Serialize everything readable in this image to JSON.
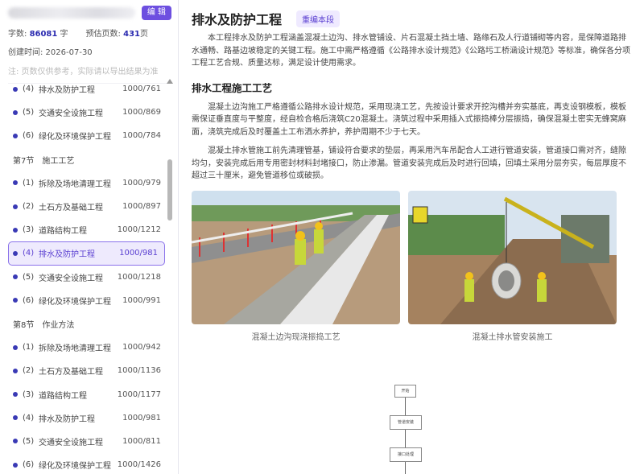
{
  "sidebar": {
    "edit_label": "编 辑",
    "word_count_label": "字数:",
    "word_count": "86081",
    "word_unit": "字",
    "pages_label": "预估页数:",
    "pages": "431",
    "pages_unit": "页",
    "created": "创建时间: 2026-07-30",
    "note": "注: 页数仅供参考，实际请以导出结果为准",
    "toc": [
      {
        "type": "item",
        "num": "(4)",
        "label": "排水及防护工程",
        "pages": "1000/761"
      },
      {
        "type": "item",
        "num": "(5)",
        "label": "交通安全设施工程",
        "pages": "1000/869"
      },
      {
        "type": "item",
        "num": "(6)",
        "label": "绿化及环境保护工程",
        "pages": "1000/784"
      },
      {
        "type": "section",
        "label": "第7节　施工工艺"
      },
      {
        "type": "item",
        "num": "(1)",
        "label": "拆除及场地清理工程",
        "pages": "1000/979"
      },
      {
        "type": "item",
        "num": "(2)",
        "label": "土石方及基础工程",
        "pages": "1000/897"
      },
      {
        "type": "item",
        "num": "(3)",
        "label": "道路结构工程",
        "pages": "1000/1212"
      },
      {
        "type": "item",
        "num": "(4)",
        "label": "排水及防护工程",
        "pages": "1000/981",
        "active": true
      },
      {
        "type": "item",
        "num": "(5)",
        "label": "交通安全设施工程",
        "pages": "1000/1218"
      },
      {
        "type": "item",
        "num": "(6)",
        "label": "绿化及环境保护工程",
        "pages": "1000/991"
      },
      {
        "type": "section",
        "label": "第8节　作业方法"
      },
      {
        "type": "item",
        "num": "(1)",
        "label": "拆除及场地清理工程",
        "pages": "1000/942"
      },
      {
        "type": "item",
        "num": "(2)",
        "label": "土石方及基础工程",
        "pages": "1000/1136"
      },
      {
        "type": "item",
        "num": "(3)",
        "label": "道路结构工程",
        "pages": "1000/1177"
      },
      {
        "type": "item",
        "num": "(4)",
        "label": "排水及防护工程",
        "pages": "1000/981"
      },
      {
        "type": "item",
        "num": "(5)",
        "label": "交通安全设施工程",
        "pages": "1000/811"
      },
      {
        "type": "item",
        "num": "(6)",
        "label": "绿化及环境保护工程",
        "pages": "1000/1426"
      }
    ]
  },
  "main": {
    "title": "排水及防护工程",
    "regen_label": "重编本段",
    "intro": "本工程排水及防护工程涵盖混凝土边沟、排水管铺设、片石混凝土挡土墙、路缘石及人行道铺砌等内容，是保障道路排水通畅、路基边坡稳定的关键工程。施工中需严格遵循《公路排水设计规范》《公路圬工桥涵设计规范》等标准，确保各分项工程工艺合规、质量达标，满足设计使用需求。",
    "subtitle": "排水工程施工工艺",
    "para1": "混凝土边沟施工严格遵循公路排水设计规范，采用现浇工艺，先按设计要求开挖沟槽并夯实基底，再支设钢模板，模板需保证垂直度与平整度，经自检合格后浇筑C20混凝土。浇筑过程中采用插入式振捣棒分层振捣，确保混凝土密实无蜂窝麻面，浇筑完成后及时覆盖土工布洒水养护，养护周期不少于七天。",
    "para2": "混凝土排水管施工前先清理管基，铺设符合要求的垫层，再采用汽车吊配合人工进行管道安装，管道接口需对齐，缝隙均匀，安装完成后用专用密封材料封堵接口，防止渗漏。管道安装完成后及时进行回填，回填土采用分层夯实，每层厚度不超过三十厘米，避免管道移位或破损。",
    "captions": [
      "混凝土边沟现浇振捣工艺",
      "混凝土排水管安装施工"
    ],
    "flow_labels": [
      "开始",
      "管道安装",
      "接口处理"
    ]
  }
}
